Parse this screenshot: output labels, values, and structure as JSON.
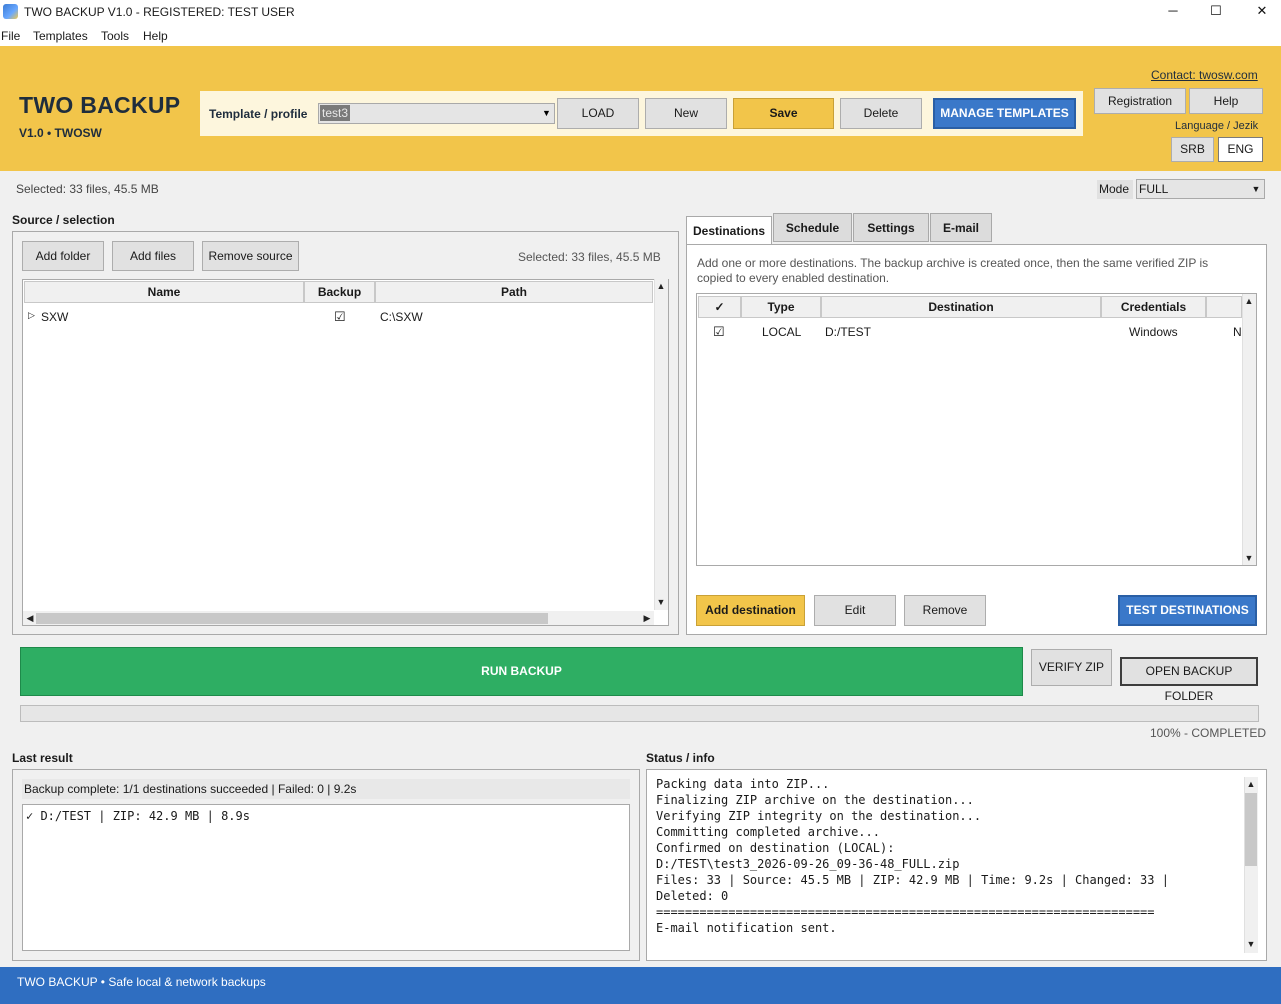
{
  "window": {
    "title": "TWO BACKUP V1.0 - REGISTERED: TEST USER",
    "minimize_glyph": "─",
    "maximize_glyph": "☐",
    "close_glyph": "✕"
  },
  "menu": [
    "File",
    "Templates",
    "Tools",
    "Help"
  ],
  "brand": {
    "title": "TWO BACKUP",
    "subtitle": "V1.0  •  TWOSW"
  },
  "template": {
    "label": "Template / profile",
    "value": "test3",
    "load": "LOAD",
    "new": "New",
    "save": "Save",
    "delete": "Delete",
    "manage": "MANAGE TEMPLATES"
  },
  "header_right": {
    "contact": "Contact: twosw.com",
    "registration": "Registration",
    "help": "Help",
    "language_label": "Language / Jezik",
    "lang_srb": "SRB",
    "lang_eng": "ENG"
  },
  "summary": {
    "selected": "Selected: 33 files, 45.5 MB",
    "mode_label": "Mode",
    "mode_value": "FULL"
  },
  "source": {
    "title": "Source / selection",
    "add_folder": "Add folder",
    "add_files": "Add files",
    "remove_source": "Remove source",
    "selected": "Selected: 33 files, 45.5 MB",
    "columns": [
      "Name",
      "Backup",
      "Path"
    ],
    "rows": [
      {
        "name": "SXW",
        "backup": "☑",
        "path": "C:\\SXW"
      }
    ]
  },
  "destinations": {
    "tabs": [
      "Destinations",
      "Schedule",
      "Settings",
      "E-mail"
    ],
    "description": "Add one or more destinations. The backup archive is created once, then the same verified ZIP is copied to every enabled destination.",
    "columns": [
      "✓",
      "Type",
      "Destination",
      "Credentials"
    ],
    "rows": [
      {
        "enabled": "☑",
        "type": "LOCAL",
        "destination": "D:/TEST",
        "credentials": "Windows",
        "extra": "N"
      }
    ],
    "add": "Add destination",
    "edit": "Edit",
    "remove": "Remove",
    "test": "TEST DESTINATIONS"
  },
  "actions": {
    "run": "RUN BACKUP",
    "verify": "VERIFY ZIP",
    "open_folder": "OPEN BACKUP FOLDER"
  },
  "progress": {
    "percent": 100,
    "label": "100% - COMPLETED"
  },
  "last_result": {
    "title": "Last result",
    "summary": "Backup complete: 1/1 destinations succeeded | Failed: 0 | 9.2s",
    "lines": [
      "✓  D:/TEST | ZIP: 42.9 MB | 8.9s"
    ]
  },
  "status": {
    "title": "Status / info",
    "lines": [
      "Packing data into ZIP...",
      "Finalizing ZIP archive on the destination...",
      "Verifying ZIP integrity on the destination...",
      "Committing completed archive...",
      "Confirmed on destination (LOCAL):",
      "D:/TEST\\test3_2026-09-26_09-36-48_FULL.zip",
      "Files: 33 | Source: 45.5 MB | ZIP: 42.9 MB | Time: 9.2s | Changed: 33 |",
      "Deleted: 0",
      "=====================================================================",
      "E-mail notification sent."
    ]
  },
  "footer": {
    "text": "TWO BACKUP  •  Safe local & network backups"
  },
  "colors": {
    "accent_yellow": "#f2c54a",
    "accent_blue": "#3a78c9",
    "run_green": "#2eae63",
    "footer_blue": "#2f6ec1"
  }
}
